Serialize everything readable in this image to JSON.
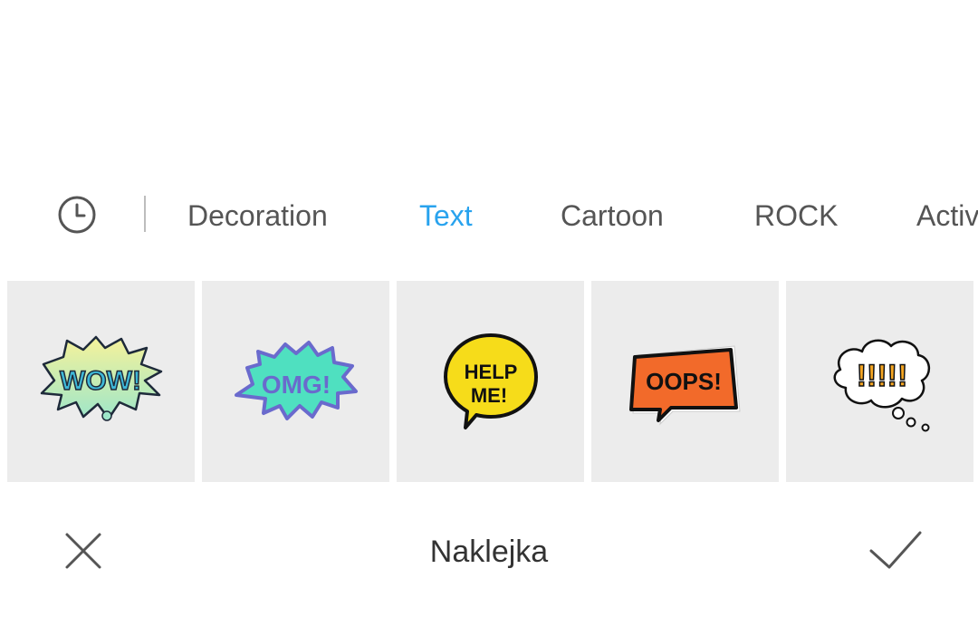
{
  "tabs": {
    "recent_icon": "clock-icon",
    "items": [
      {
        "label": "Decoration",
        "active": false
      },
      {
        "label": "Text",
        "active": true
      },
      {
        "label": "Cartoon",
        "active": false
      },
      {
        "label": "ROCK",
        "active": false
      },
      {
        "label": "Activ",
        "active": false
      }
    ],
    "active_color": "#29a3ee",
    "inactive_color": "#555555"
  },
  "stickers": [
    {
      "name": "wow-sticker",
      "text": "WOW!"
    },
    {
      "name": "omg-sticker",
      "text": "OMG!"
    },
    {
      "name": "help-me-sticker",
      "text_line1": "HELP",
      "text_line2": "ME!"
    },
    {
      "name": "oops-sticker",
      "text": "OOPS!"
    },
    {
      "name": "thought-cloud-sticker",
      "text": "!!!!!"
    }
  ],
  "bottom_bar": {
    "title": "Naklejka",
    "close_icon": "close-icon",
    "confirm_icon": "checkmark-icon"
  }
}
